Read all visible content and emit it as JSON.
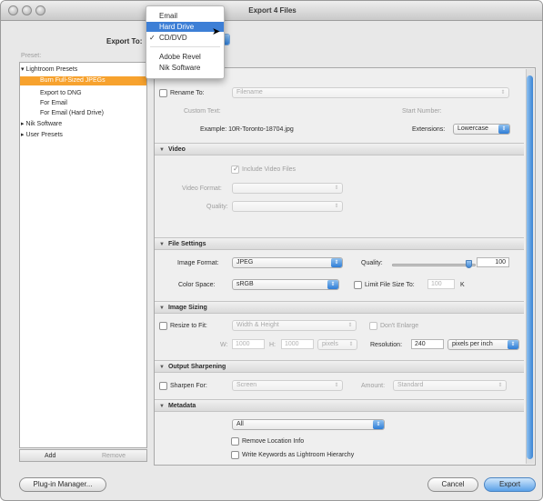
{
  "window": {
    "title": "Export 4 Files"
  },
  "export_to": {
    "label": "Export To:",
    "menu_items": [
      "Email",
      "Hard Drive",
      "CD/DVD",
      "Adobe Revel",
      "Nik Software"
    ],
    "highlighted": "Hard Drive",
    "checked": "CD/DVD"
  },
  "presets": {
    "header": "Preset:",
    "items": [
      {
        "label": "Lightroom Presets",
        "expander": "▾"
      },
      {
        "label": "Burn Full-Sized JPEGs"
      },
      {
        "label": "Export to DNG"
      },
      {
        "label": "For Email"
      },
      {
        "label": "For Email (Hard Drive)"
      },
      {
        "label": "Nik Software",
        "expander": "▸"
      },
      {
        "label": "User Presets",
        "expander": "▸"
      }
    ],
    "add_label": "Add",
    "remove_label": "Remove"
  },
  "file_naming": {
    "rename_to_label": "Rename To:",
    "rename_to_value": "Filename",
    "custom_text_label": "Custom Text:",
    "start_number_label": "Start Number:",
    "example_label": "Example: 10R-Toronto-18704.jpg",
    "extensions_label": "Extensions:",
    "extensions_value": "Lowercase"
  },
  "video": {
    "header": "Video",
    "include_label": "Include Video Files",
    "format_label": "Video Format:",
    "quality_label": "Quality:"
  },
  "file_settings": {
    "header": "File Settings",
    "format_label": "Image Format:",
    "format_value": "JPEG",
    "quality_label": "Quality:",
    "quality_value": "100",
    "quality_fraction": 0.92,
    "color_space_label": "Color Space:",
    "color_space_value": "sRGB",
    "limit_label": "Limit File Size To:",
    "limit_value": "100",
    "limit_unit": "K"
  },
  "image_sizing": {
    "header": "Image Sizing",
    "resize_label": "Resize to Fit:",
    "resize_value": "Width & Height",
    "dont_enlarge_label": "Don't Enlarge",
    "w_label": "W:",
    "w_value": "1000",
    "h_label": "H:",
    "h_value": "1000",
    "units_value": "pixels",
    "resolution_label": "Resolution:",
    "resolution_value": "240",
    "resolution_units": "pixels per inch"
  },
  "output_sharpening": {
    "header": "Output Sharpening",
    "sharpen_label": "Sharpen For:",
    "sharpen_value": "Screen",
    "amount_label": "Amount:",
    "amount_value": "Standard"
  },
  "metadata": {
    "header": "Metadata",
    "include_value": "All",
    "remove_location_label": "Remove Location Info",
    "write_keywords_label": "Write Keywords as Lightroom Hierarchy"
  },
  "footer": {
    "plugin_manager_label": "Plug-in Manager...",
    "cancel_label": "Cancel",
    "export_label": "Export"
  },
  "colors": {
    "accent": "#3b87d8",
    "selection": "#f7a22e",
    "menu_highlight": "#3d7fd6"
  }
}
